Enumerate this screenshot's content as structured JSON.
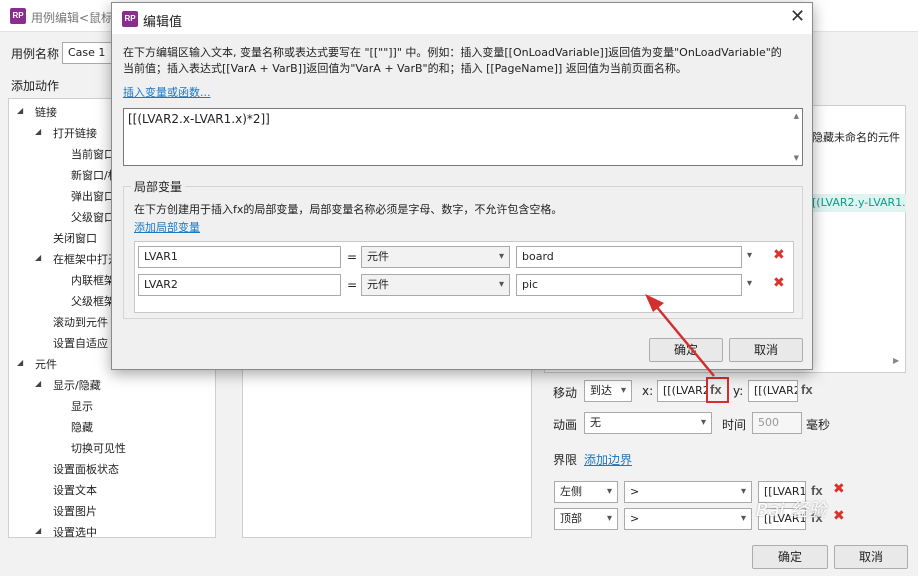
{
  "back_window": {
    "title": "用例编辑<鼠标",
    "case_name_label": "用例名称",
    "case_name_value": "Case 1",
    "add_action_label": "添加动作",
    "hide_unnamed_label": "隐藏未命名的元件",
    "right_highlight_text": "[(LVAR2.y-LVAR1.",
    "tree": {
      "link": "链接",
      "open_link": "打开链接",
      "current_window": "当前窗口",
      "new_window": "新窗口/标",
      "popup_window": "弹出窗口",
      "parent_window": "父级窗口",
      "close_window": "关闭窗口",
      "open_in_frame": "在框架中打开",
      "inline_frame": "内联框架",
      "parent_frame": "父级框架",
      "scroll_to_widget": "滚动到元件",
      "set_adaptive": "设置自适应",
      "widgets": "元件",
      "show_hide": "显示/隐藏",
      "show": "显示",
      "hide": "隐藏",
      "toggle_visibility": "切换可见性",
      "set_panel_state": "设置面板状态",
      "set_text": "设置文本",
      "set_image": "设置图片",
      "set_selected": "设置选中"
    },
    "move": {
      "label": "移动",
      "mode": "到达",
      "x_label": "x:",
      "x_value": "[[(LVAR2",
      "y_label": "y:",
      "y_value": "[[(LVAR2",
      "fx": "fx"
    },
    "animation": {
      "label": "动画",
      "value": "无",
      "time_label": "时间",
      "time_value": "500",
      "unit": "毫秒"
    },
    "bounds": {
      "label": "界限",
      "add_link": "添加边界",
      "rows": [
        {
          "side": "左侧",
          "op": ">",
          "value": "[[LVAR1.",
          "fx": "fx"
        },
        {
          "side": "顶部",
          "op": ">",
          "value": "[[LVAR1.",
          "fx": "fx"
        }
      ]
    },
    "ok": "确定",
    "cancel": "取消"
  },
  "dialog": {
    "title": "编辑值",
    "instruction_line1": "在下方编辑区输入文本, 变量名称或表达式要写在 \"[[\"\"]]\" 中。例如：插入变量[[OnLoadVariable]]返回值为变量\"OnLoadVariable\"的",
    "instruction_line2": "当前值；插入表达式[[VarA + VarB]]返回值为\"VarA + VarB\"的和；插入 [[PageName]] 返回值为当前页面名称。",
    "insert_link": "插入变量或函数...",
    "expression": "[[(LVAR2.x-LVAR1.x)*2]]",
    "local_vars": {
      "legend": "局部变量",
      "description": "在下方创建用于插入fx的局部变量，局部变量名称必须是字母、数字，不允许包含空格。",
      "add_link": "添加局部变量",
      "rows": [
        {
          "name": "LVAR1",
          "eq": "=",
          "type": "元件",
          "target": "board"
        },
        {
          "name": "LVAR2",
          "eq": "=",
          "type": "元件",
          "target": "pic"
        }
      ]
    },
    "ok": "确定",
    "cancel": "取消"
  },
  "watermark": "Bai 经验",
  "colors": {
    "accent_red": "#d32f2f",
    "logo_purple": "#8a2d8f",
    "link_blue": "#1a78c2",
    "highlight_teal": "#0a9c8c"
  }
}
